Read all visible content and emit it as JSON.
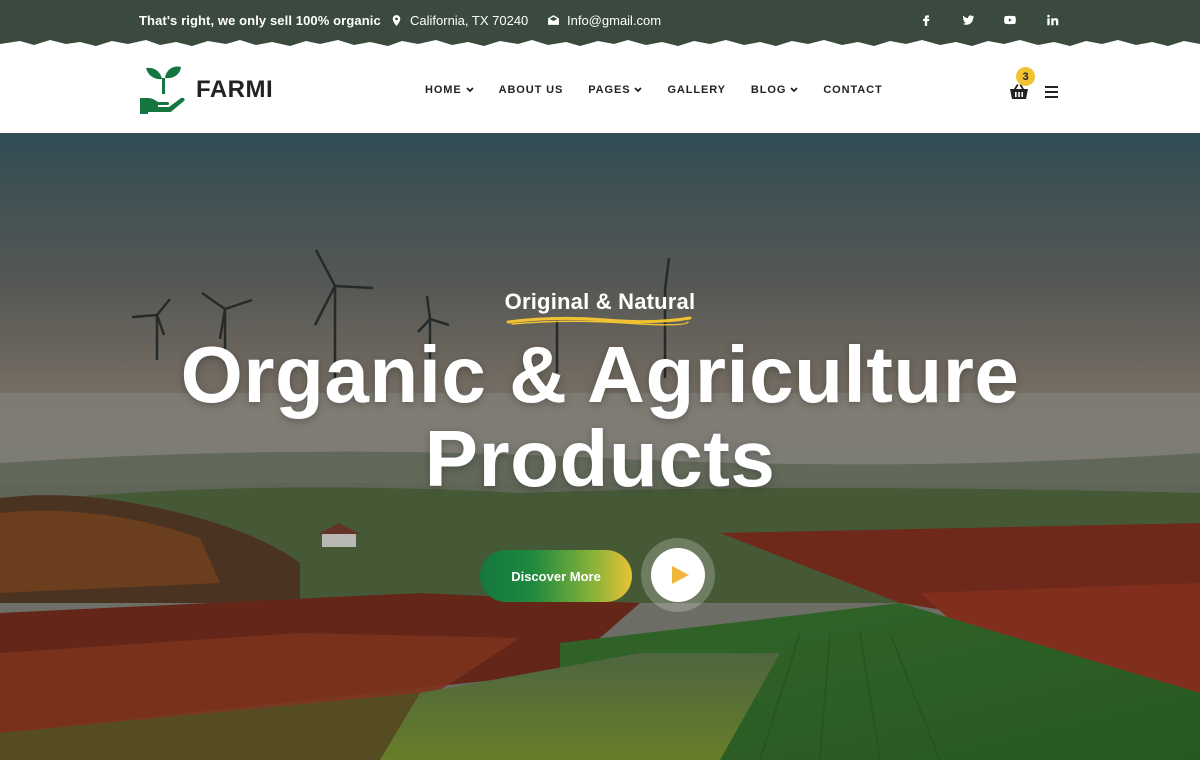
{
  "topbar": {
    "tagline": "That's right, we only sell 100% organic",
    "location": "California, TX 70240",
    "email": "Info@gmail.com",
    "social": [
      "facebook-icon",
      "twitter-icon",
      "youtube-icon",
      "linkedin-icon"
    ]
  },
  "header": {
    "brand": "FARMI",
    "nav": [
      {
        "label": "HOME",
        "dropdown": true
      },
      {
        "label": "ABOUT US",
        "dropdown": false
      },
      {
        "label": "PAGES",
        "dropdown": true
      },
      {
        "label": "GALLERY",
        "dropdown": false
      },
      {
        "label": "BLOG",
        "dropdown": true
      },
      {
        "label": "CONTACT",
        "dropdown": false
      }
    ],
    "cart_count": "3",
    "icons": [
      "cart-icon",
      "menu-icon"
    ]
  },
  "hero": {
    "subtitle": "Original & Natural",
    "title_line1": "Organic & Agriculture",
    "title_line2": "Products",
    "cta_label": "Discover More",
    "play_icon": "play-icon"
  },
  "colors": {
    "topbar": "#3b4a3f",
    "brand_green": "#15773f",
    "accent_yellow": "#e9c233",
    "play_icon": "#f0b53a"
  }
}
